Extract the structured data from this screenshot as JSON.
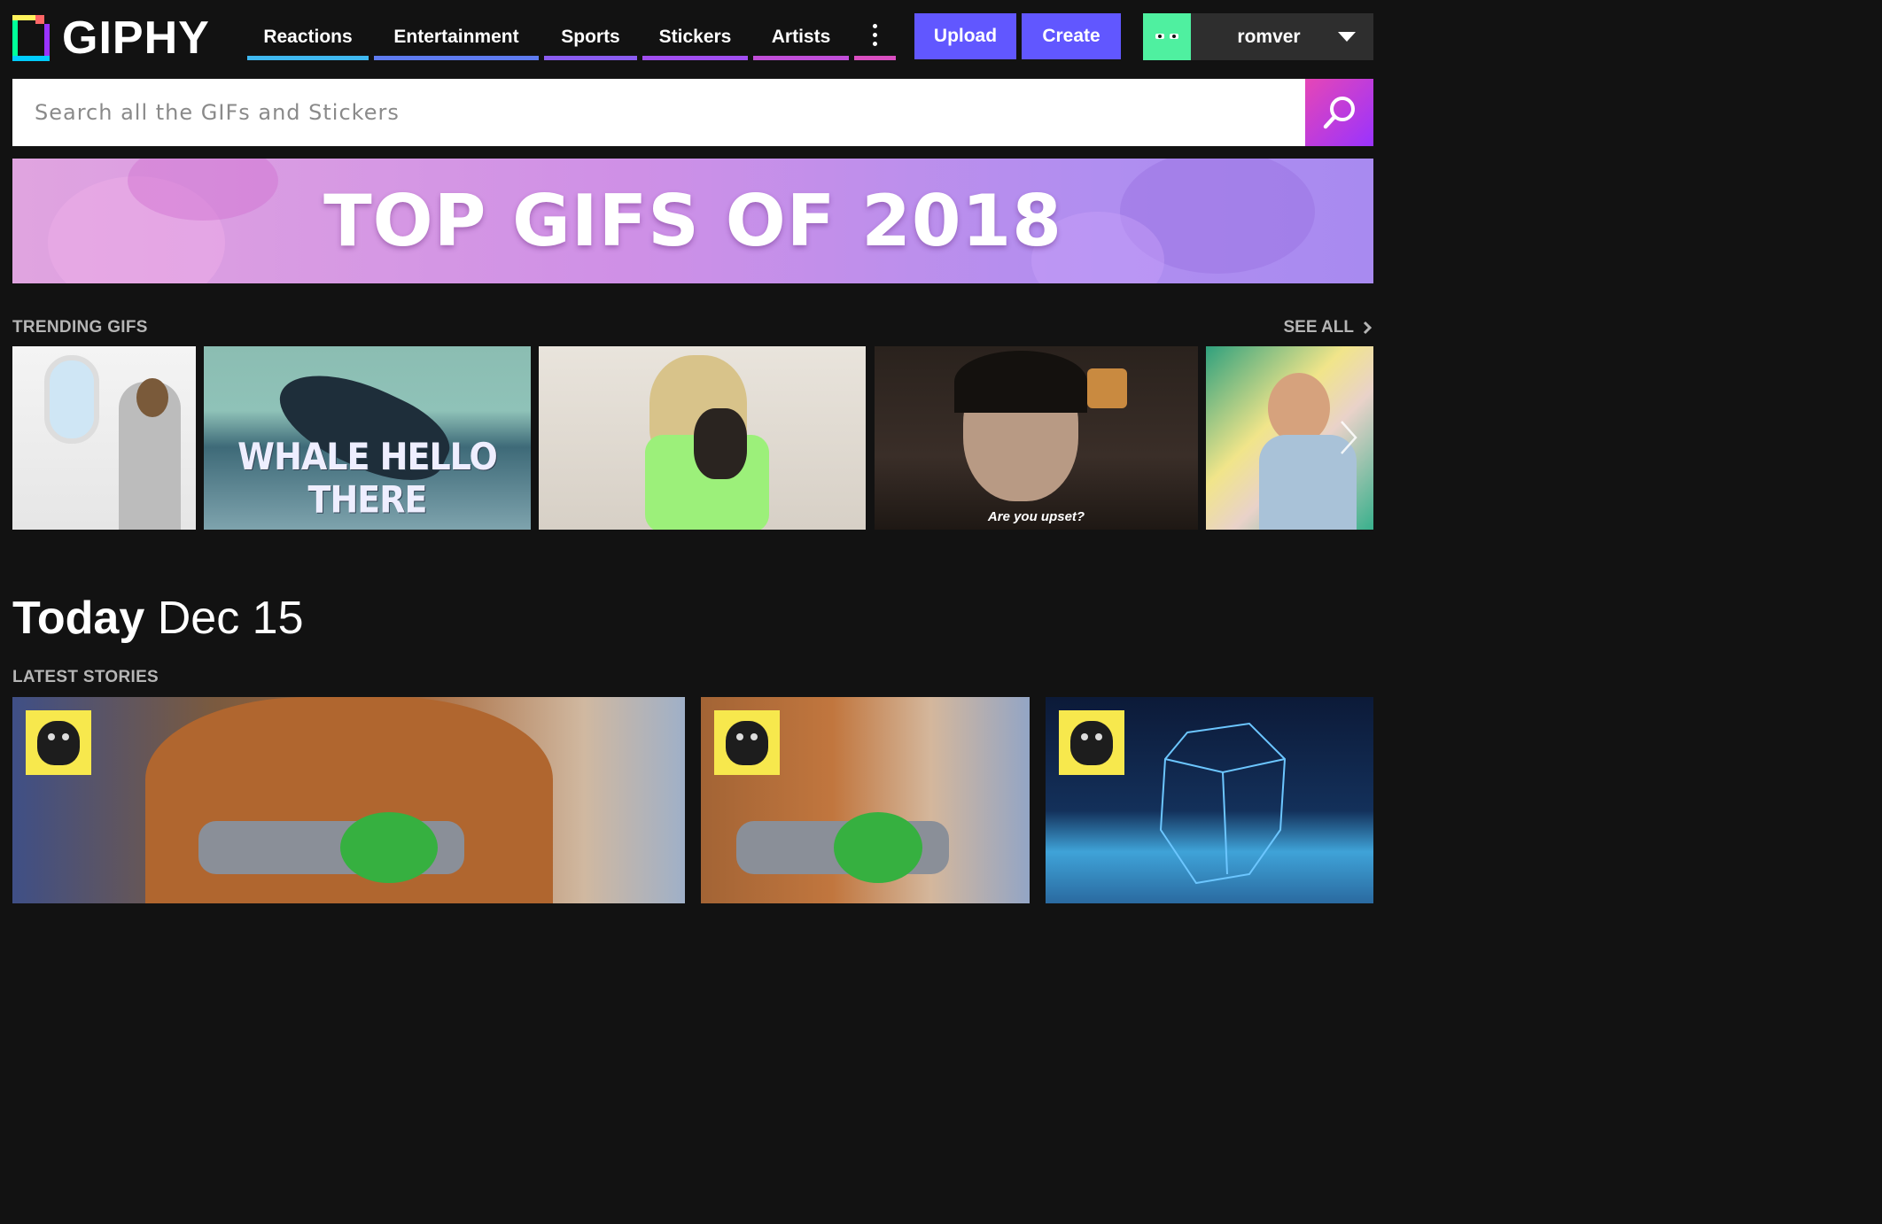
{
  "brand": {
    "name": "GIPHY"
  },
  "nav": {
    "items": [
      {
        "label": "Reactions",
        "color": "#3fb8f0"
      },
      {
        "label": "Entertainment",
        "color": "#5e7bf0"
      },
      {
        "label": "Sports",
        "color": "#8a5cf0"
      },
      {
        "label": "Stickers",
        "color": "#a04ef0"
      },
      {
        "label": "Artists",
        "color": "#c04ed8"
      }
    ],
    "more_color": "#d94ec0"
  },
  "actions": {
    "upload": "Upload",
    "create": "Create"
  },
  "user": {
    "name": "romver"
  },
  "search": {
    "placeholder": "Search all the GIFs and Stickers"
  },
  "banner": {
    "title": "TOP GIFS OF 2018"
  },
  "trending": {
    "label": "TRENDING GIFS",
    "see_all": "SEE ALL",
    "gifs": [
      {
        "caption": ""
      },
      {
        "caption": "WHALE HELLO THERE"
      },
      {
        "caption": ""
      },
      {
        "caption": "Are you upset?"
      },
      {
        "caption": ""
      }
    ]
  },
  "today": {
    "prefix": "Today",
    "date": "Dec 15"
  },
  "stories": {
    "label": "LATEST STORIES"
  },
  "colors": {
    "accent": "#6157ff",
    "background": "#121212",
    "avatar": "#4ff0a0"
  }
}
